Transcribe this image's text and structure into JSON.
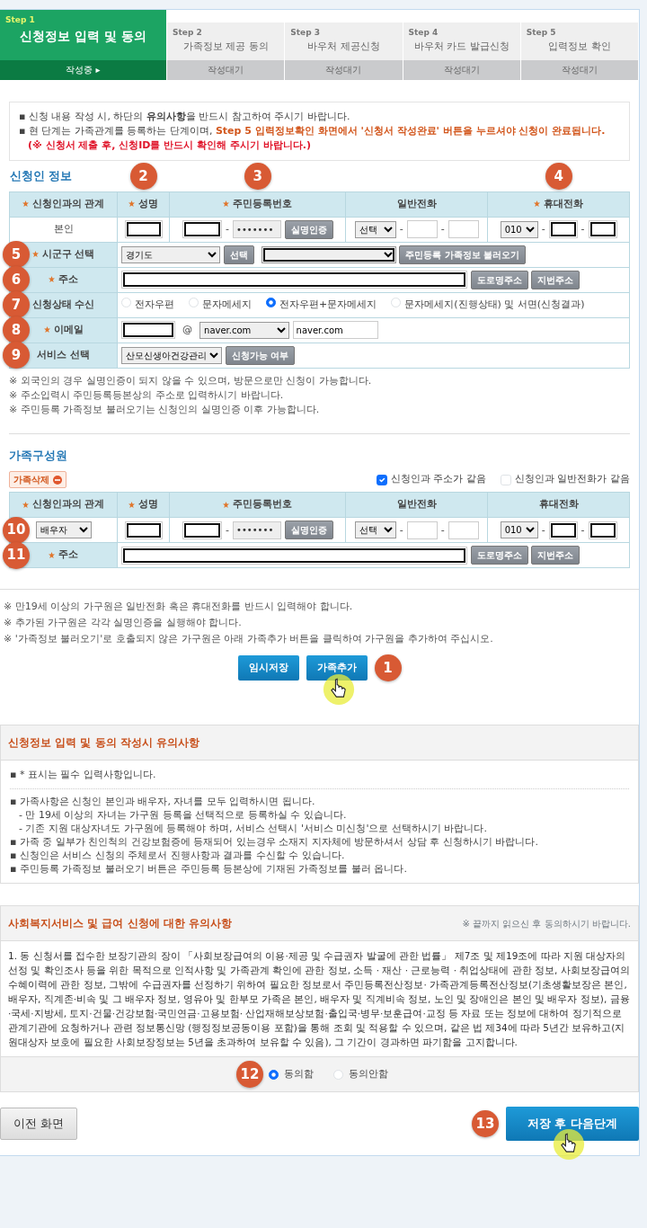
{
  "steps": [
    {
      "step": "Step 1",
      "title": "신청정보 입력 및 동의",
      "status": "작성중 ▸",
      "selected": true
    },
    {
      "step": "Step 2",
      "title": "가족정보 제공 동의",
      "status": "작성대기",
      "selected": false
    },
    {
      "step": "Step 3",
      "title": "바우처 제공신청",
      "status": "작성대기",
      "selected": false
    },
    {
      "step": "Step 4",
      "title": "바우처 카드 발급신청",
      "status": "작성대기",
      "selected": false
    },
    {
      "step": "Step 5",
      "title": "입력정보 확인",
      "status": "작성대기",
      "selected": false
    }
  ],
  "notice": {
    "lines": [
      {
        "text": "▪ 신청 내용 작성 시, 하단의 **유의사항**을 반드시 참고하여 주시기 바랍니다."
      },
      {
        "text": "▪ 현 단계는 가족관계를 등록하는 단계이며, ",
        "highlight": "Step 5 입력정보확인 화면에서 '신청서 작성완료' 버튼을 누르셔야 신청이 완료됩니다.",
        "warning": "(※ 신청서 제출 후, 신청ID를 반드시 확인해 주시기 바랍니다.)"
      }
    ]
  },
  "applicant": {
    "title": "신청인 정보",
    "columns": [
      {
        "label": "신청인과의 관계",
        "required": true
      },
      {
        "label": "성명",
        "required": true,
        "badge": "2"
      },
      {
        "label": "주민등록번호",
        "required": true,
        "badge": "3"
      },
      {
        "label": "일반전화",
        "required": false
      },
      {
        "label": "휴대전화",
        "required": true,
        "badge": "4"
      }
    ],
    "row": {
      "relation": "본인",
      "separator": "-",
      "id_mask": "•••••••",
      "verify_button": "실명인증",
      "phone_area": "선택",
      "mobile_prefix": "010"
    },
    "fields": [
      {
        "kind": "region",
        "label": "시군구 선택",
        "required": true,
        "badge": "5",
        "province": "경기도",
        "select_button": "선택",
        "load_button": "주민등록 가족정보 불러오기"
      },
      {
        "kind": "address",
        "label": "주소",
        "required": true,
        "badge": "6",
        "buttons": [
          "도로명주소",
          "지번주소"
        ]
      },
      {
        "kind": "radios",
        "label": "신청상태 수신",
        "required": false,
        "badge": "7",
        "options": [
          {
            "label": "전자우편",
            "selected": false
          },
          {
            "label": "문자메세지",
            "selected": false
          },
          {
            "label": "전자우편+문자메세지",
            "selected": true
          },
          {
            "label": "문자메세지(진행상태) 및 서면(신청결과)",
            "selected": false
          }
        ]
      },
      {
        "kind": "email",
        "label": "이메일",
        "required": true,
        "badge": "8",
        "at": "@",
        "domain_select": "naver.com",
        "domain": "naver.com"
      },
      {
        "kind": "service",
        "label": "서비스 선택",
        "required": false,
        "badge": "9",
        "service": "산모신생아건강관리",
        "check_button": "신청가능 여부"
      }
    ],
    "notes": [
      "※ 외국인의 경우 실명인증이 되지 않을 수 있으며, 방문으로만 신청이 가능합니다.",
      "※ 주소입력시 주민등록등본상의 주소로 입력하시기 바랍니다.",
      "※ 주민등록 가족정보 불러오기는 신청인의 실명인증 이후 가능합니다."
    ]
  },
  "family": {
    "title": "가족구성원",
    "delete_button": "가족삭제",
    "options": [
      {
        "label": "신청인과 주소가 같음",
        "checked": true
      },
      {
        "label": "신청인과 일반전화가 같음",
        "checked": false
      }
    ],
    "columns": [
      {
        "label": "신청인과의 관계",
        "required": true
      },
      {
        "label": "성명",
        "required": true
      },
      {
        "label": "주민등록번호",
        "required": true
      },
      {
        "label": "일반전화",
        "required": false
      },
      {
        "label": "휴대전화",
        "required": false
      }
    ],
    "row": {
      "relation": "배우자",
      "badge": "10",
      "separator": "-",
      "id_mask": "•••••••",
      "verify_button": "실명인증",
      "phone_area": "선택",
      "mobile_prefix": "010"
    },
    "address": {
      "label": "주소",
      "required": true,
      "badge": "11",
      "buttons": [
        "도로명주소",
        "지번주소"
      ]
    }
  },
  "family_notes": [
    "※ 만19세 이상의 가구원은 일반전화 혹은 휴대전화를 반드시 입력해야 합니다.",
    "※ 추가된 가구원은 각각 실명인증을 실행해야 합니다.",
    "※ '가족정보 불러오기'로 호출되지 않은 가구원은 아래 가족추가 버튼을 클릭하여 가구원을 추가하여 주십시오."
  ],
  "actions": [
    {
      "label": "임시저장",
      "cursor": false
    },
    {
      "label": "가족추가",
      "badge": "1",
      "cursor": true
    }
  ],
  "caution": {
    "title": "신청정보 입력 및 동의 작성시 유의사항",
    "required_note": "▪ * 표시는 필수 입력사항입니다.",
    "items": [
      {
        "text": "▪ 가족사항은 신청인 본인과 배우자, 자녀를 모두 입력하시면 됩니다.",
        "children": [
          {
            "text": "- 만 19세 이상의 자녀는 가구원 등록을 선택적으로 등록하실 수 있습니다."
          },
          {
            "text": "- 기존 지원 대상자녀도 가구원에 등록해야 하며, 서비스 선택시 '서비스 미신청'으로 선택하시기 바랍니다."
          }
        ]
      },
      {
        "text": "▪ 가족 중 일부가 친인척의 건강보험증에 등재되어 있는경우 소재지 지자체에 방문하셔서 상담 후 신청하시기 바랍니다."
      },
      {
        "text": "▪ 신청인은 서비스 신청의 주체로서 진행사항과 결과를 수신할 수 있습니다."
      },
      {
        "text": "▪ 주민등록 가족정보 불러오기 버튼은 주민등록 등본상에 기재된 가족정보를 불러 옵니다."
      }
    ]
  },
  "welfare": {
    "title": "사회복지서비스 및 급여 신청에 대한 유의사항",
    "hint": "※ 끝까지 읽으신 후 동의하시기 바랍니다.",
    "body": "1. 동 신청서를 접수한 보장기관의 장이 「사회보장급여의 이용·제공 및 수급권자 발굴에 관한 법률」 제7조 및 제19조에 따라 지원 대상자의 선정 및 확인조사 등을 위한 목적으로 인적사항 및 가족관계 확인에 관한 정보, 소득 · 재산 · 근로능력 · 취업상태에 관한 정보, 사회보장급여의 수혜이력에 관한 정보, 그밖에 수급권자를 선정하기 위하여 필요한 정보로서 주민등록전산정보· 가족관계등록전산정보(기초생활보장은 본인, 배우자, 직계존·비속 및 그 배우자 정보, 영유아 및 한부모 가족은 본인, 배우자 및 직계비속 정보, 노인 및 장애인은 본인 및 배우자 정보), 금융·국세·지방세, 토지·건물·건강보험·국민연금·고용보험· 산업재해보상보험·출입국·병무·보훈급여·교정 등 자료 또는 정보에 대하여 정기적으로 관계기관에 요청하거나 관련 정보통신망 (행정정보공동이용 포함)을 통해 조회 및 적용할 수 있으며, 같은 법 제34에 따라 5년간 보유하고(지원대상자 보호에 필요한 사회보장정보는 5년을 초과하여 보유할 수 있음), 그 기간이 경과하면 파기함을 고지합니다.",
    "badge": "12",
    "agree": [
      {
        "label": "동의함",
        "selected": true
      },
      {
        "label": "동의안함",
        "selected": false
      }
    ]
  },
  "footer": {
    "prev_button": "이전 화면",
    "next": {
      "label": "저장 후 다음단계",
      "badge": "13",
      "cursor": true
    }
  }
}
